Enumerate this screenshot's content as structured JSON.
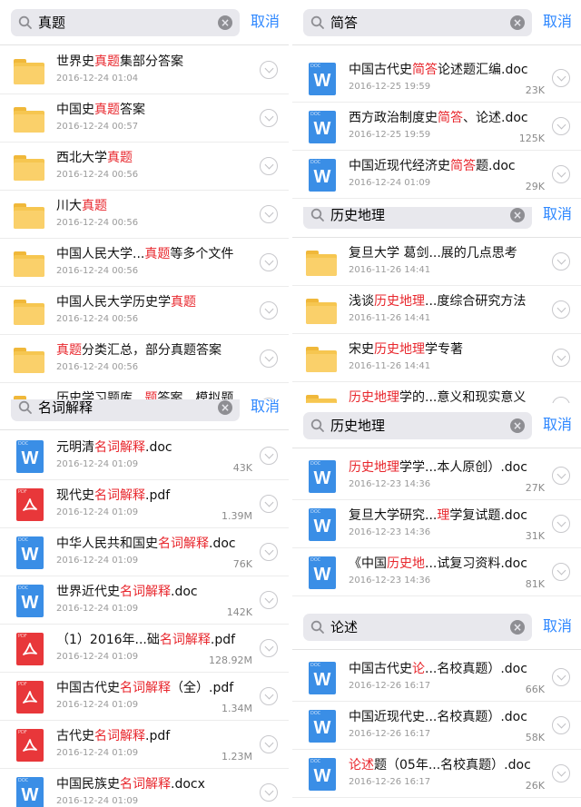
{
  "colors": {
    "accent": "#2f88ff",
    "highlight": "#e8262c",
    "folder": "#f6c650",
    "word": "#3a8ee6",
    "pdf": "#e8373a"
  },
  "cancel_label": "取消",
  "panels": [
    {
      "id": "left-top",
      "query": "真题",
      "items": [
        {
          "type": "folder",
          "pre": "世界史",
          "hl": "真题",
          "post": "集部分答案",
          "date": "2016-12-24 01:04",
          "size": ""
        },
        {
          "type": "folder",
          "pre": "中国史",
          "hl": "真题",
          "post": "答案",
          "date": "2016-12-24 00:57",
          "size": ""
        },
        {
          "type": "folder",
          "pre": "西北大学",
          "hl": "真题",
          "post": "",
          "date": "2016-12-24 00:56",
          "size": ""
        },
        {
          "type": "folder",
          "pre": "川大",
          "hl": "真题",
          "post": "",
          "date": "2016-12-24 00:56",
          "size": ""
        },
        {
          "type": "folder",
          "pre": "中国人民大学...",
          "hl": "真题",
          "post": "等多个文件",
          "date": "2016-12-24 00:56",
          "size": ""
        },
        {
          "type": "folder",
          "pre": "中国人民大学历史学",
          "hl": "真题",
          "post": "",
          "date": "2016-12-24 00:56",
          "size": ""
        },
        {
          "type": "folder",
          "pre": "",
          "hl": "真题",
          "post": "分类汇总，部分真题答案",
          "date": "2016-12-24 00:56",
          "size": ""
        },
        {
          "type": "folder",
          "pre": "历史学习题库...",
          "hl": "题",
          "post": "答案、模拟题",
          "date": "",
          "size": ""
        }
      ]
    },
    {
      "id": "left-bottom",
      "query": "名词解释",
      "items": [
        {
          "type": "word",
          "pre": "元明清",
          "hl": "名词解释",
          "post": ".doc",
          "date": "2016-12-24 01:09",
          "size": "43K"
        },
        {
          "type": "pdf",
          "pre": "现代史",
          "hl": "名词解释",
          "post": ".pdf",
          "date": "2016-12-24 01:09",
          "size": "1.39M"
        },
        {
          "type": "word",
          "pre": "中华人民共和国史",
          "hl": "名词解释",
          "post": ".doc",
          "date": "2016-12-24 01:09",
          "size": "76K"
        },
        {
          "type": "word",
          "pre": "世界近代史",
          "hl": "名词解释",
          "post": ".doc",
          "date": "2016-12-24 01:09",
          "size": "142K"
        },
        {
          "type": "pdf",
          "pre": "（1）2016年...础",
          "hl": "名词解释",
          "post": ".pdf",
          "date": "2016-12-24 01:09",
          "size": "128.92M"
        },
        {
          "type": "pdf",
          "pre": "中国古代史",
          "hl": "名词解释",
          "post": "（全）.pdf",
          "date": "2016-12-24 01:09",
          "size": "1.34M"
        },
        {
          "type": "pdf",
          "pre": "古代史",
          "hl": "名词解释",
          "post": ".pdf",
          "date": "2016-12-24 01:09",
          "size": "1.23M"
        },
        {
          "type": "word",
          "pre": "中国民族史",
          "hl": "名词解释",
          "post": ".docx",
          "date": "2016-12-24 01:09",
          "size": ""
        }
      ]
    },
    {
      "id": "right-1",
      "query": "简答",
      "items": [
        {
          "type": "word",
          "pre": "中国古代史",
          "hl": "简答",
          "post": "论述题汇编.doc",
          "date": "2016-12-25 19:59",
          "size": "23K"
        },
        {
          "type": "word",
          "pre": "西方政治制度史",
          "hl": "简答",
          "post": "、论述.doc",
          "date": "2016-12-25 19:59",
          "size": "125K"
        },
        {
          "type": "word",
          "pre": "中国近现代经济史",
          "hl": "简答",
          "post": "题.doc",
          "date": "2016-12-24 01:09",
          "size": "29K"
        }
      ]
    },
    {
      "id": "right-2",
      "query": "历史地理",
      "items": [
        {
          "type": "folder",
          "pre": "复旦大学 葛剑...展的几点思考",
          "hl": "",
          "post": "",
          "date": "2016-11-26 14:41",
          "size": ""
        },
        {
          "type": "folder",
          "pre": "浅谈",
          "hl": "历史地理",
          "post": "...度综合研究方法",
          "date": "2016-11-26 14:41",
          "size": ""
        },
        {
          "type": "folder",
          "pre": "宋史",
          "hl": "历史地理",
          "post": "学专著",
          "date": "2016-11-26 14:41",
          "size": ""
        },
        {
          "type": "folder",
          "pre": "",
          "hl": "历史地理",
          "post": "学的...意义和现实意义",
          "date": "",
          "size": ""
        }
      ]
    },
    {
      "id": "right-3",
      "query": "历史地理",
      "items": [
        {
          "type": "word",
          "pre": "",
          "hl": "历史地理",
          "post": "学学...本人原创）.doc",
          "date": "2016-12-23 14:36",
          "size": "27K"
        },
        {
          "type": "word",
          "pre": "复旦大学研究...",
          "hl": "理",
          "post": "学复试题.doc",
          "date": "2016-12-23 14:36",
          "size": "31K"
        },
        {
          "type": "word",
          "pre": "《中国",
          "hl": "历史地",
          "post": "...试复习资料.doc",
          "date": "2016-12-23 14:36",
          "size": "81K"
        }
      ]
    },
    {
      "id": "right-4",
      "query": "论述",
      "items": [
        {
          "type": "word",
          "pre": "中国古代史",
          "hl": "论",
          "post": "...名校真题）.doc",
          "date": "2016-12-26 16:17",
          "size": "66K"
        },
        {
          "type": "word",
          "pre": "中国近现代史...名校真题）.doc",
          "hl": "",
          "post": "",
          "date": "2016-12-26 16:17",
          "size": "58K"
        },
        {
          "type": "word",
          "pre": "",
          "hl": "论述",
          "post": "题（05年...名校真题）.doc",
          "date": "2016-12-26 16:17",
          "size": "26K"
        }
      ]
    }
  ]
}
